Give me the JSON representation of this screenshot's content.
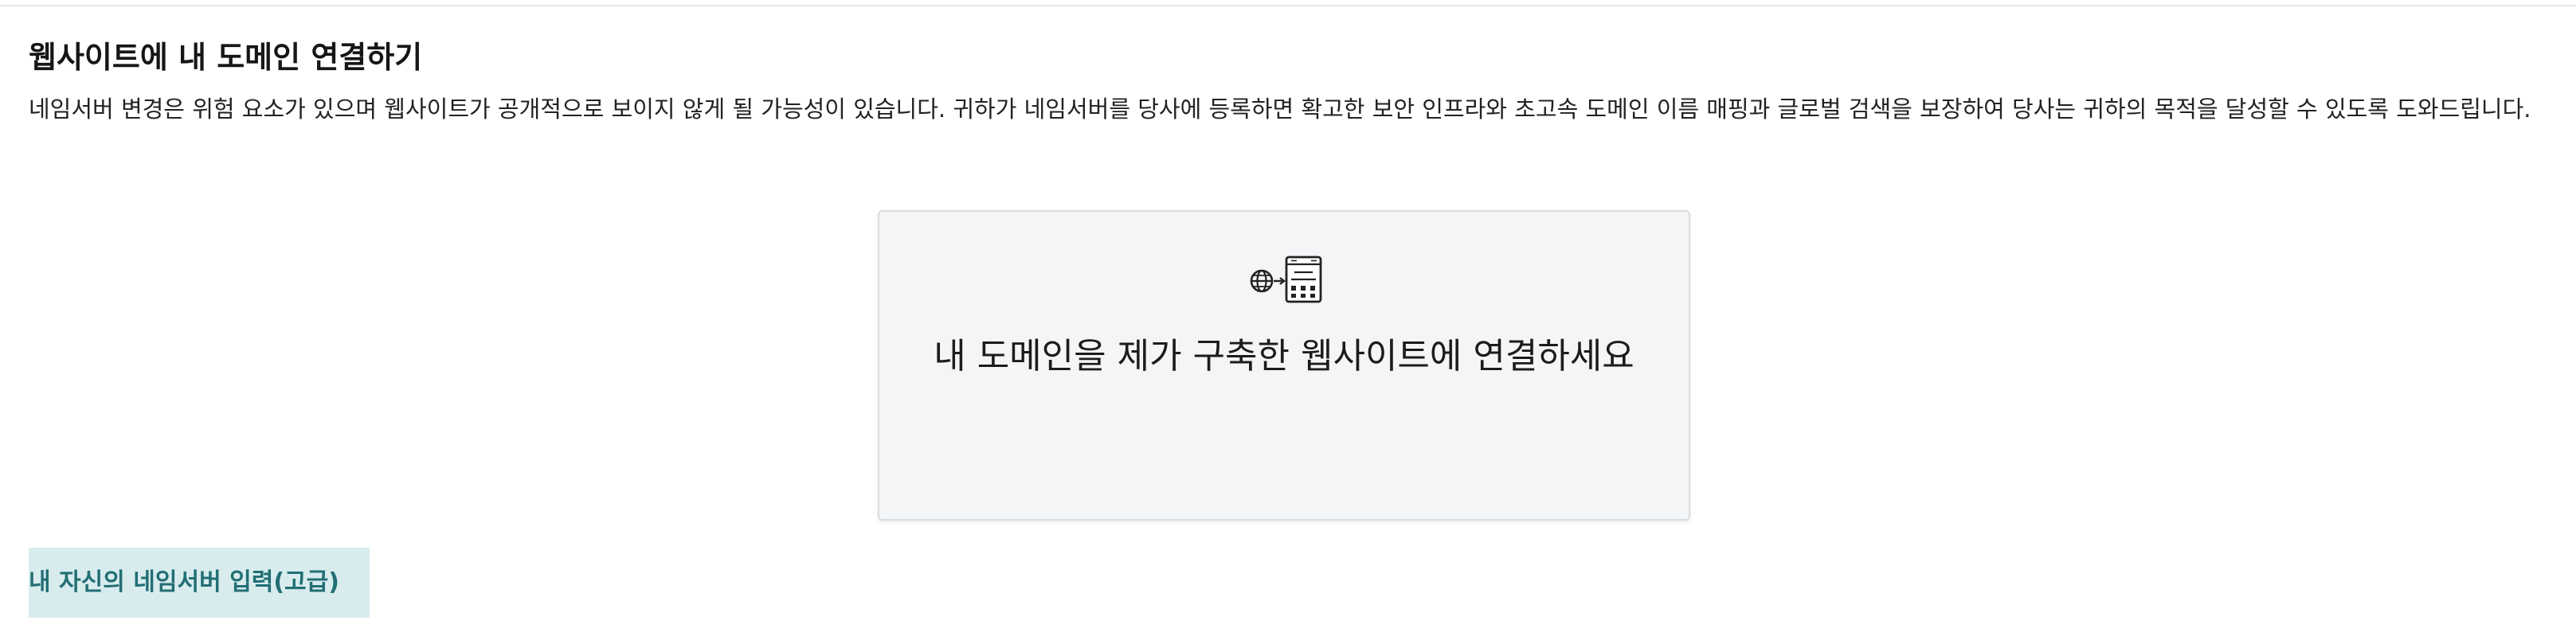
{
  "header": {
    "title": "웹사이트에 내 도메인 연결하기",
    "description": "네임서버 변경은 위험 요소가 있으며 웹사이트가 공개적으로 보이지 않게 될 가능성이 있습니다. 귀하가 네임서버를 당사에 등록하면 확고한 보안 인프라와 초고속 도메인 이름 매핑과 글로벌 검색을 보장하여 당사는 귀하의 목적을 달성할 수 있도록 도와드립니다."
  },
  "connect_card": {
    "icon": "globe-to-server-icon",
    "label": "내 도메인을 제가 구축한 웹사이트에 연결하세요"
  },
  "advanced": {
    "button_label": "내 자신의 네임서버 입력(고급)"
  },
  "colors": {
    "card_background": "#f4f5f7",
    "advanced_button_background": "#d8ecee",
    "advanced_button_text": "#226f74"
  }
}
